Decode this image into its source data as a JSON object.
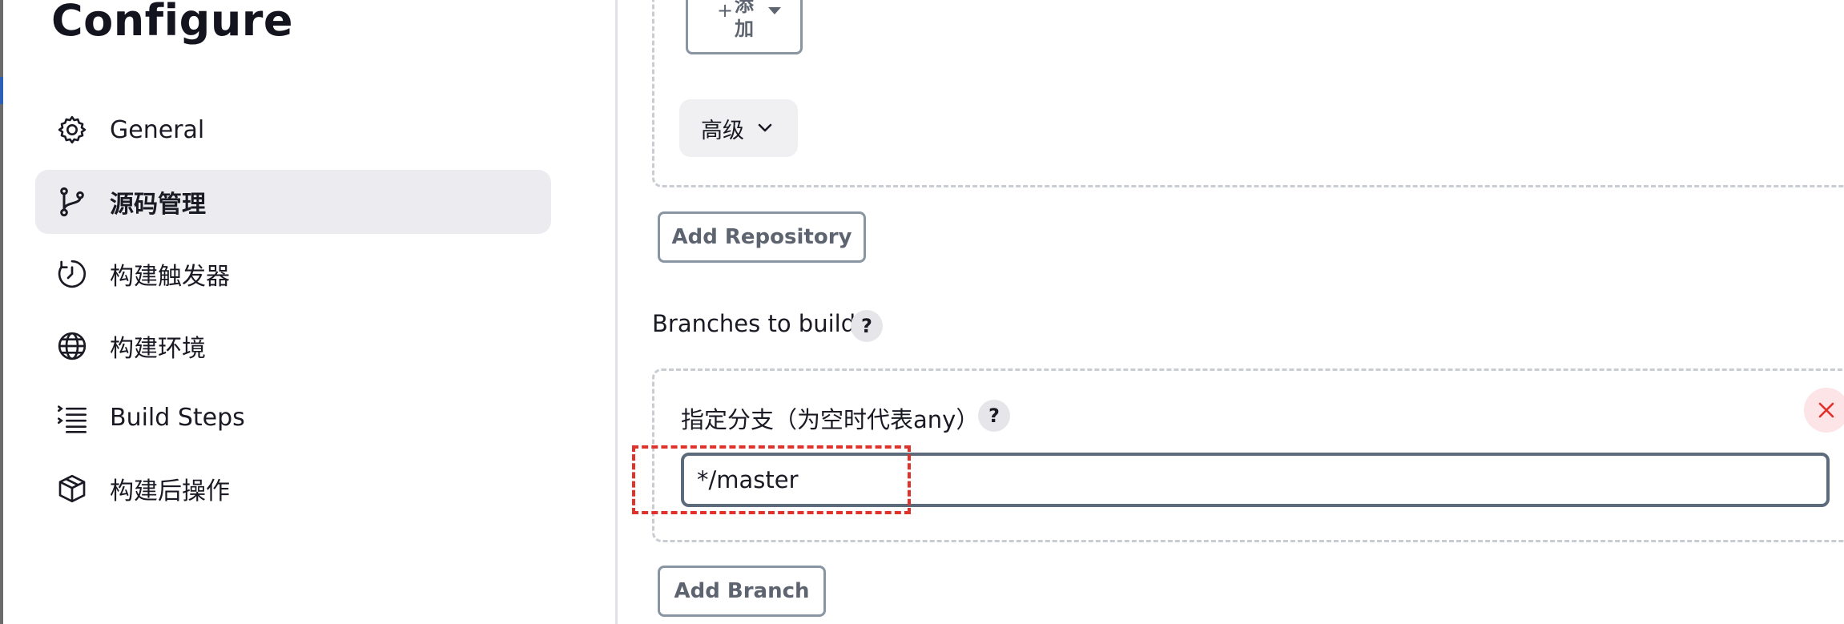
{
  "sidebar": {
    "title": "Configure",
    "items": [
      {
        "label": "General",
        "icon": "gear-icon",
        "active": false
      },
      {
        "label": "源码管理",
        "icon": "git-branch-icon",
        "active": true
      },
      {
        "label": "构建触发器",
        "icon": "clock-icon",
        "active": false
      },
      {
        "label": "构建环境",
        "icon": "globe-icon",
        "active": false
      },
      {
        "label": "Build Steps",
        "icon": "list-steps-icon",
        "active": false
      },
      {
        "label": "构建后操作",
        "icon": "package-icon",
        "active": false
      }
    ]
  },
  "repository": {
    "add_dropdown_label": "添加",
    "add_dropdown_plus": "+",
    "advanced_label": "高级",
    "add_repository_label": "Add Repository"
  },
  "branches": {
    "section_label": "Branches to build",
    "help_mark": "?",
    "branch_field_label": "指定分支（为空时代表any）",
    "branch_value": "*/master",
    "add_branch_label": "Add Branch"
  },
  "colors": {
    "active_nav_bg": "#ececf0",
    "button_border": "#8a95a3",
    "input_border": "#5b6b7c",
    "close_bg": "#fde4e6",
    "close_icon": "#e0322a",
    "highlight": "#e0322a"
  }
}
